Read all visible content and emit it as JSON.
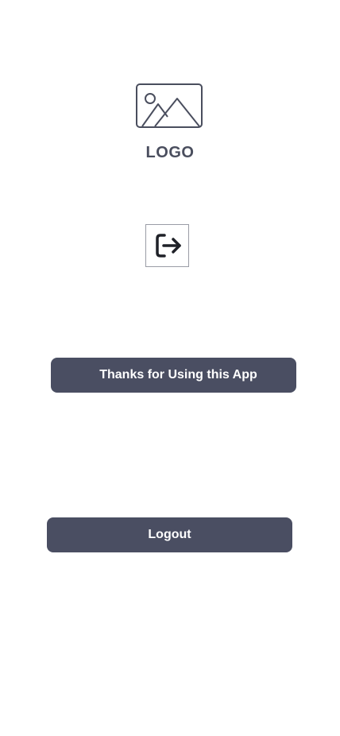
{
  "header": {
    "logo_icon": "image-placeholder-icon",
    "logo_label": "LOGO"
  },
  "main": {
    "status_icon": "logout-icon",
    "thanks_label": "Thanks for Using this App",
    "logout_label": "Logout"
  },
  "colors": {
    "button_bg": "#4a4e62",
    "logo_text": "#4a4e5e",
    "icon_stroke": "#4a4e5e"
  }
}
